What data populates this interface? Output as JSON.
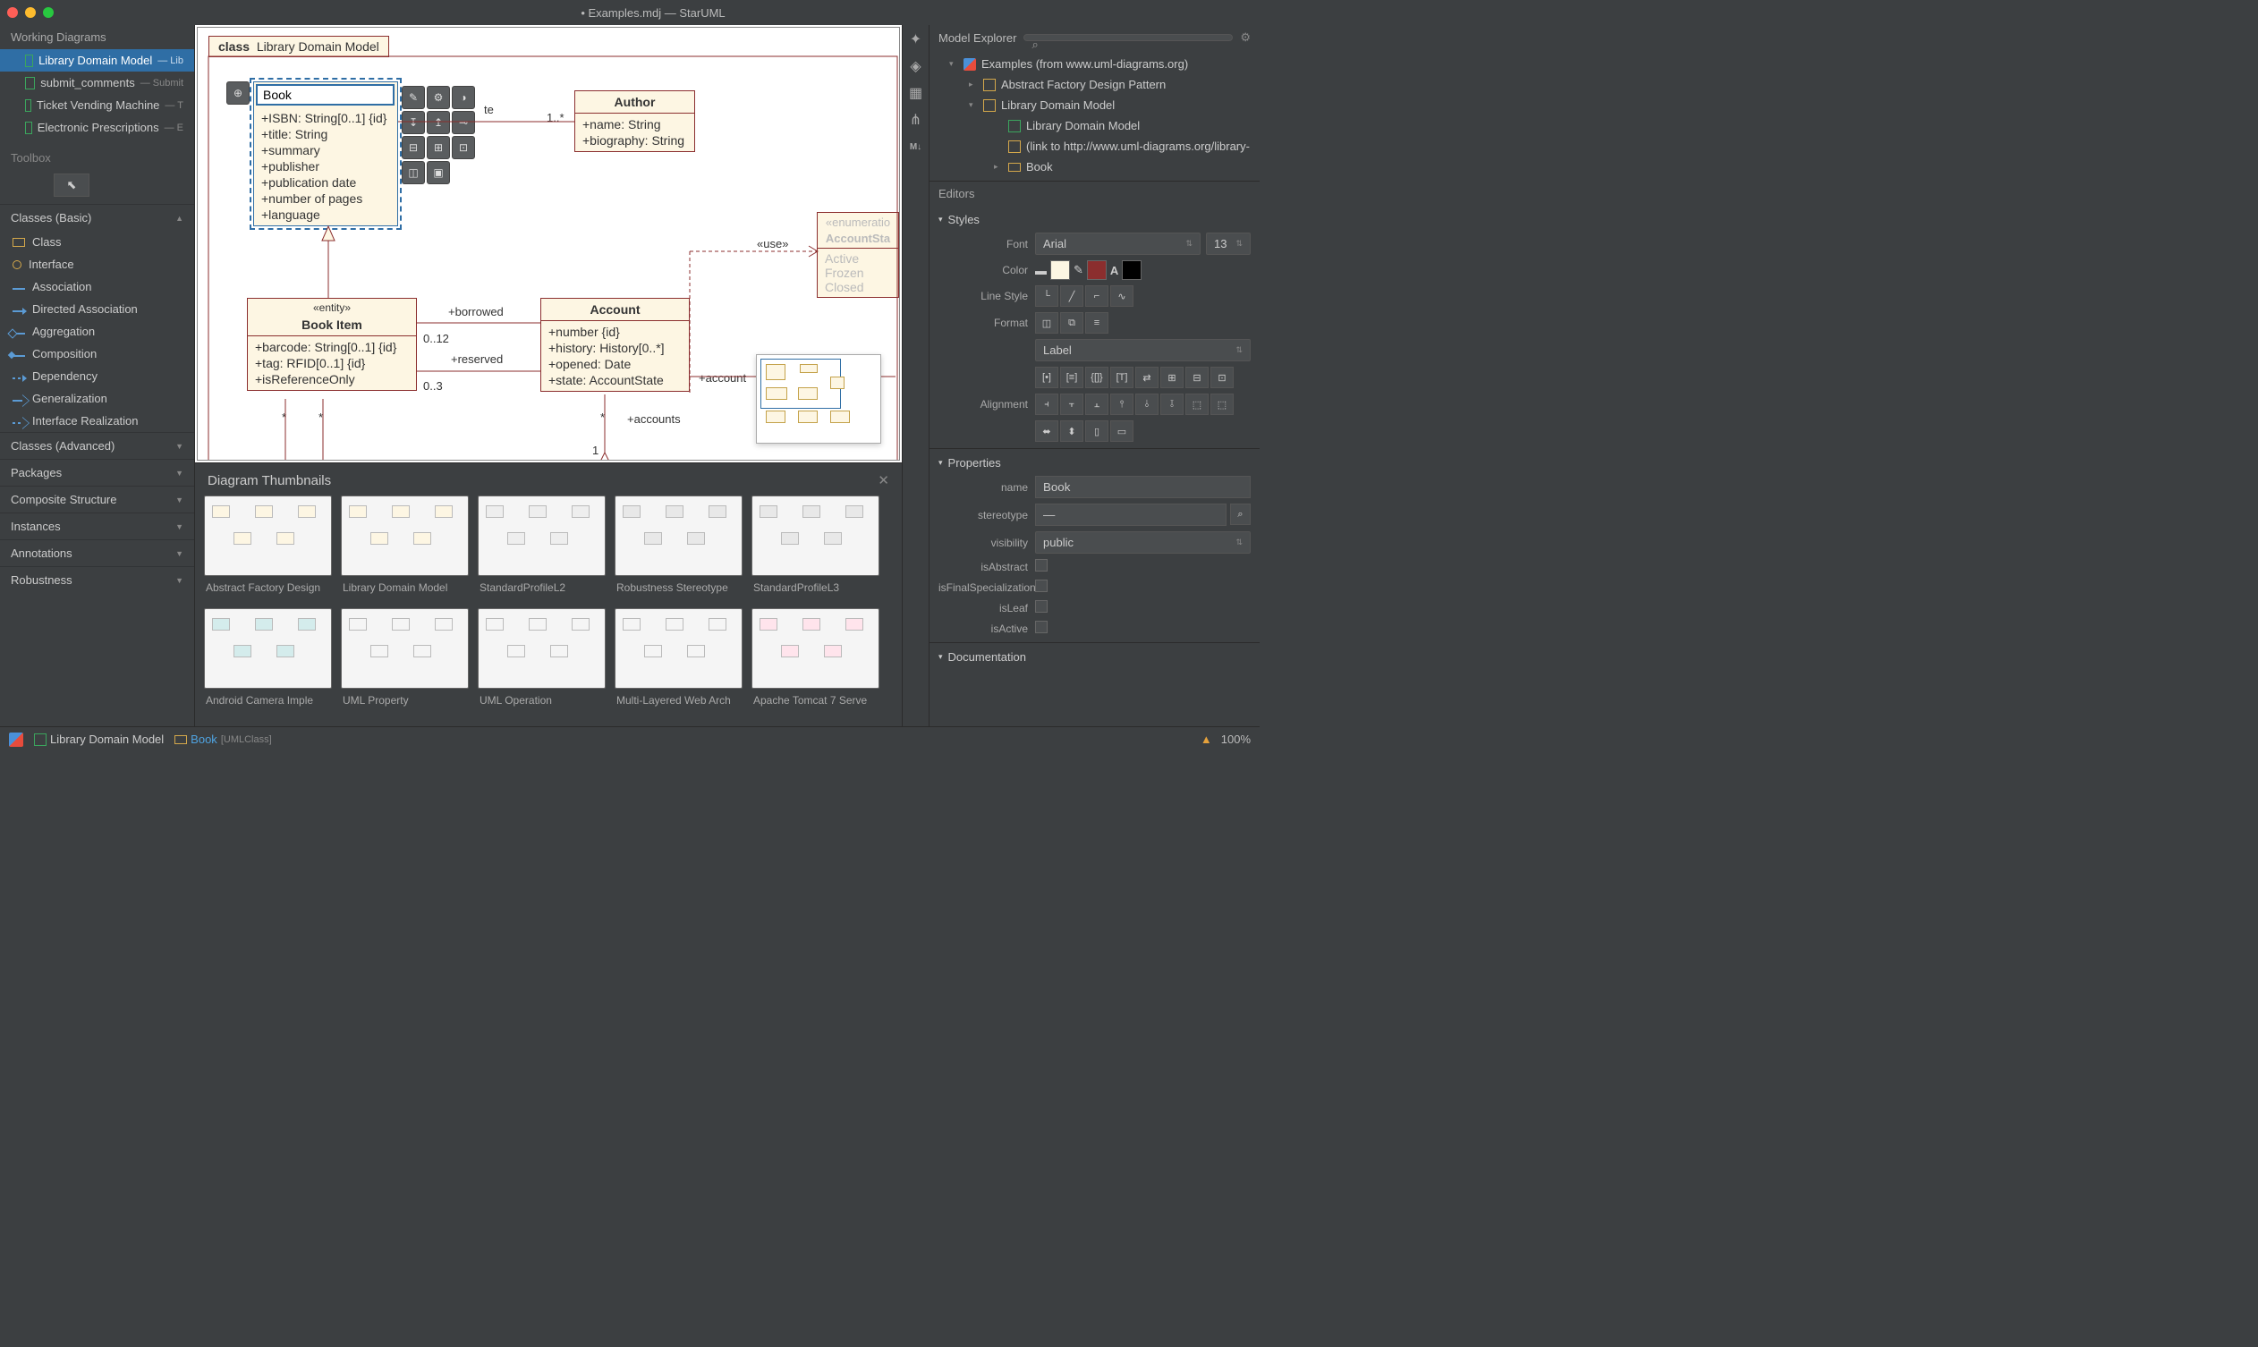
{
  "window": {
    "title": "• Examples.mdj — StarUML"
  },
  "workingDiagrams": {
    "title": "Working Diagrams",
    "items": [
      {
        "name": "Library Domain Model",
        "sub": "— Lib"
      },
      {
        "name": "submit_comments",
        "sub": "— Submit"
      },
      {
        "name": "Ticket Vending Machine",
        "sub": "— T"
      },
      {
        "name": "Electronic Prescriptions",
        "sub": "— E"
      }
    ]
  },
  "toolbox": {
    "title": "Toolbox",
    "sections": {
      "classesBasic": {
        "label": "Classes (Basic)",
        "tools": [
          "Class",
          "Interface",
          "Association",
          "Directed Association",
          "Aggregation",
          "Composition",
          "Dependency",
          "Generalization",
          "Interface Realization"
        ]
      },
      "collapsed": [
        "Classes (Advanced)",
        "Packages",
        "Composite Structure",
        "Instances",
        "Annotations",
        "Robustness"
      ]
    }
  },
  "canvas": {
    "diagramLabelClass": "class",
    "diagramLabelName": "Library Domain Model",
    "book": {
      "name": "Book",
      "attrs": [
        "+ISBN: String[0..1] {id}",
        "+title: String",
        "+summary",
        "+publisher",
        "+publication date",
        "+number of pages",
        "+language"
      ]
    },
    "author": {
      "name": "Author",
      "attrs": [
        "+name: String",
        "+biography: String"
      ]
    },
    "bookItem": {
      "stereo": "«entity»",
      "name": "Book Item",
      "attrs": [
        "+barcode: String[0..1] {id}",
        "+tag: RFID[0..1] {id}",
        "+isReferenceOnly"
      ]
    },
    "account": {
      "name": "Account",
      "attrs": [
        "+number {id}",
        "+history: History[0..*]",
        "+opened: Date",
        "+state: AccountState"
      ]
    },
    "enum": {
      "stereo": "«enumeratio",
      "name": "AccountSta",
      "lits": [
        "Active",
        "Frozen",
        "Closed"
      ]
    },
    "labels": {
      "mult_author": "1..*",
      "borrowed": "+borrowed",
      "borrowed_mult": "0..12",
      "reserved": "+reserved",
      "reserved_mult": "0..3",
      "use": "«use»",
      "account_role": "+account",
      "accounts_role": "+accounts",
      "star1": "*",
      "star2": "*",
      "star3": "*",
      "one": "1",
      "dateLabel": "te"
    }
  },
  "thumbnails": {
    "title": "Diagram Thumbnails",
    "items": [
      "Abstract Factory Design",
      "Library Domain Model",
      "StandardProfileL2",
      "Robustness Stereotype",
      "StandardProfileL3",
      "Android Camera Imple",
      "UML Property",
      "UML Operation",
      "Multi-Layered Web Arch",
      "Apache Tomcat 7 Serve"
    ]
  },
  "modelExplorer": {
    "title": "Model Explorer",
    "tree": {
      "root": "Examples (from www.uml-diagrams.org)",
      "n1": "Abstract Factory Design Pattern",
      "n2": "Library Domain Model",
      "n2a": "Library Domain Model",
      "n2b": "(link to http://www.uml-diagrams.org/library-",
      "n2c": "Book"
    }
  },
  "editors": {
    "title": "Editors"
  },
  "styles": {
    "title": "Styles",
    "font": {
      "label": "Font",
      "family": "Arial",
      "size": "13"
    },
    "color": {
      "label": "Color",
      "fill": "#fdf6e3",
      "line": "#8b2e2e",
      "text": "#000000"
    },
    "lineStyle": {
      "label": "Line Style"
    },
    "format": {
      "label": "Format",
      "formatValue": "Label"
    },
    "alignment": {
      "label": "Alignment"
    }
  },
  "properties": {
    "title": "Properties",
    "name": {
      "label": "name",
      "value": "Book"
    },
    "stereotype": {
      "label": "stereotype",
      "value": "—"
    },
    "visibility": {
      "label": "visibility",
      "value": "public"
    },
    "isAbstract": {
      "label": "isAbstract"
    },
    "isFinalSpecialization": {
      "label": "isFinalSpecialization"
    },
    "isLeaf": {
      "label": "isLeaf"
    },
    "isActive": {
      "label": "isActive"
    }
  },
  "documentation": {
    "title": "Documentation"
  },
  "statusbar": {
    "crumb1": "Library Domain Model",
    "crumb2": "Book",
    "crumb2_type": "[UMLClass]",
    "zoom": "100%"
  }
}
